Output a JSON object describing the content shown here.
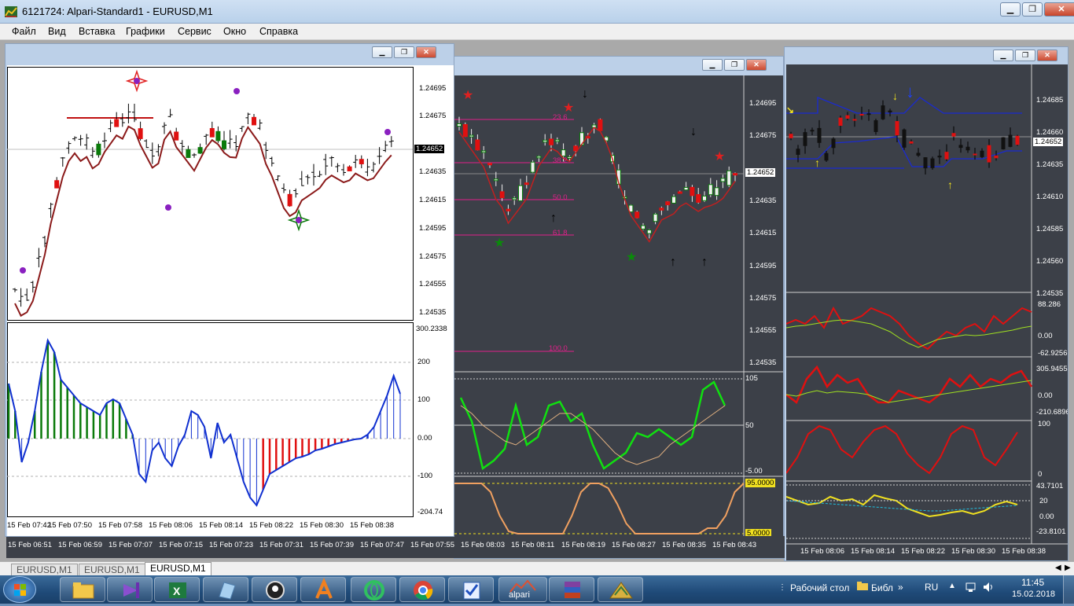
{
  "app": {
    "title": "6121724: Alpari-Standard1 - EURUSD,M1",
    "bg_title": "— ——————— —————. ————————. ——————— ——————— — ——————"
  },
  "window_buttons": {
    "minimize": "▁",
    "restore": "❐",
    "close": "✕"
  },
  "menu": [
    "Файл",
    "Вид",
    "Вставка",
    "Графики",
    "Сервис",
    "Окно",
    "Справка"
  ],
  "chart1": {
    "price_axis": [
      "1.24695",
      "1.24675",
      "1.24655",
      "1.24635",
      "1.24615",
      "1.24595",
      "1.24575",
      "1.24555",
      "1.24535"
    ],
    "current_price": "1.24652",
    "cci_axis": [
      "300.2338",
      "200",
      "100",
      "0.00",
      "-100",
      "-204.74"
    ],
    "time_axis": [
      "15 Feb 07:42",
      "15 Feb 07:50",
      "15 Feb 07:58",
      "15 Feb 08:06",
      "15 Feb 08:14",
      "15 Feb 08:22",
      "15 Feb 08:30",
      "15 Feb 08:38"
    ]
  },
  "chart2": {
    "price_axis": [
      "1.24695",
      "1.24675",
      "1.24655",
      "1.24635",
      "1.24615",
      "1.24595",
      "1.24575",
      "1.24555",
      "1.24535"
    ],
    "current_price": "1.24652",
    "fib_labels": [
      "23.6",
      "38.2",
      "50.0",
      "61.8",
      "100.0"
    ],
    "rsi_axis": [
      "105",
      "50",
      "-5.00"
    ],
    "stoch_axis": [
      "95.0000",
      "5.0000"
    ],
    "time_axis": [
      "15 Feb 06:51",
      "15 Feb 06:59",
      "15 Feb 07:07",
      "15 Feb 07:15",
      "15 Feb 07:23",
      "15 Feb 07:31",
      "15 Feb 07:39",
      "15 Feb 07:47",
      "15 Feb 07:55",
      "15 Feb 08:03",
      "15 Feb 08:11",
      "15 Feb 08:19",
      "15 Feb 08:27",
      "15 Feb 08:35",
      "15 Feb 08:43"
    ]
  },
  "chart3": {
    "price_axis": [
      "1.24685",
      "1.24660",
      "1.24635",
      "1.24610",
      "1.24585",
      "1.24560",
      "1.24535"
    ],
    "current_price": "1.24652",
    "ind1_axis": [
      "88.286",
      "0.00",
      "-62.9256"
    ],
    "ind2_axis": [
      "305.9455",
      "0.00",
      "-210.6896"
    ],
    "ind3_axis": [
      "100",
      "0"
    ],
    "ind4_axis": [
      "43.7101",
      "20",
      "0.00",
      "-23.8101"
    ],
    "time_axis": [
      "15 Feb 08:06",
      "15 Feb 08:14",
      "15 Feb 08:22",
      "15 Feb 08:30",
      "15 Feb 08:38"
    ]
  },
  "tabs": [
    "EURUSD,M1",
    "EURUSD,M1",
    "EURUSD,M1"
  ],
  "taskbar": {
    "desktop_label": "Рабочий стол",
    "lib_label": "Библ",
    "lang": "RU",
    "time": "11:45",
    "date": "15.02.2018",
    "alpari_label": "alpari"
  },
  "colors": {
    "bull": "#0a7a0a",
    "bear": "#e01010",
    "ma": "#8b1a1a",
    "cci": "#1030d0",
    "fib": "#e0208a",
    "dark_bg": "#3c4048"
  }
}
